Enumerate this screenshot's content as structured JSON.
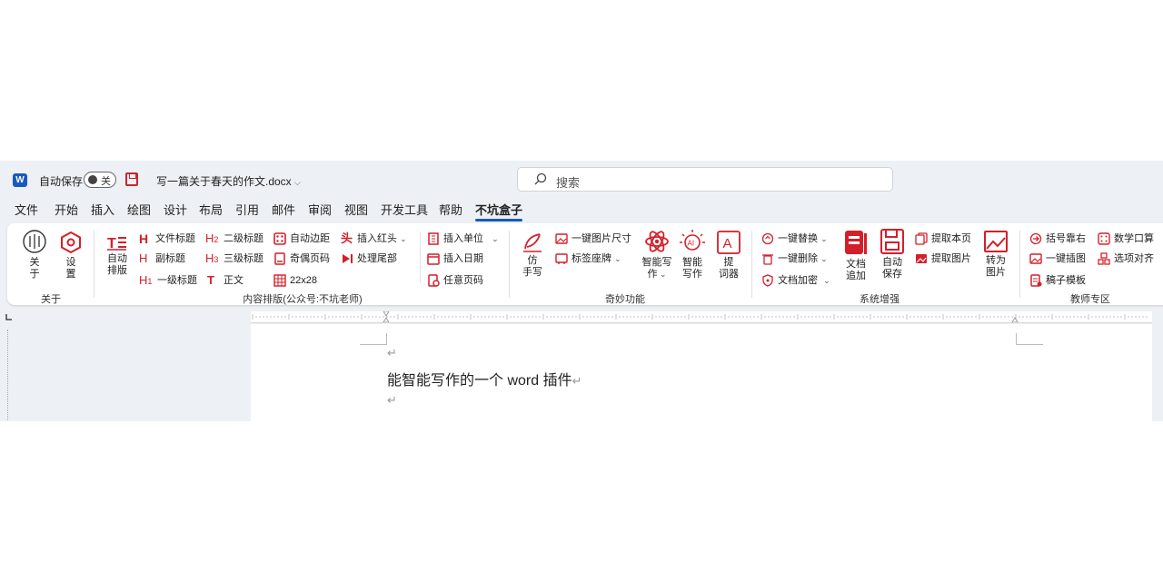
{
  "titlebar": {
    "app_logo": "W",
    "autosave_label": "自动保存",
    "autosave_state": "关",
    "doc_title": "写一篇关于春天的作文.docx",
    "search_placeholder": "搜索"
  },
  "tabs": [
    {
      "label": "文件"
    },
    {
      "label": "开始"
    },
    {
      "label": "插入"
    },
    {
      "label": "绘图"
    },
    {
      "label": "设计"
    },
    {
      "label": "布局"
    },
    {
      "label": "引用"
    },
    {
      "label": "邮件"
    },
    {
      "label": "审阅"
    },
    {
      "label": "视图"
    },
    {
      "label": "开发工具"
    },
    {
      "label": "帮助"
    },
    {
      "label": "不坑盒子",
      "active": true
    }
  ],
  "ribbon": {
    "about": {
      "group_label": "关于",
      "about_btn": "关\n于",
      "settings_btn": "设\n置"
    },
    "layout": {
      "group_label": "内容排版(公众号:不坑老师)",
      "auto_layout": "自动\n排版",
      "doc_title": "文件标题",
      "subtitle": "副标题",
      "h1": "一级标题",
      "h2": "二级标题",
      "h3": "三级标题",
      "body": "正文",
      "auto_margin": "自动边距",
      "odd_even_page": "奇偶页码",
      "grid": "22x28",
      "insert_redhead": "插入红头",
      "process_tail": "处理尾部",
      "insert_unit": "插入单位",
      "insert_date": "插入日期",
      "any_page_num": "任意页码"
    },
    "magic": {
      "group_label": "奇妙功能",
      "imitate": "仿\n手写",
      "img_size": "一键图片尺寸",
      "tag_seat": "标签座牌",
      "smart_write_menu": "智能写\n作",
      "smart_write": "智能\n写作",
      "prompt": "提\n词器"
    },
    "system": {
      "group_label": "系统增强",
      "replace": "一键替换",
      "delete": "一键删除",
      "encrypt": "文档加密",
      "doc_append": "文档\n追加",
      "auto_save": "自动\n保存",
      "extract_page": "提取本页",
      "extract_image": "提取图片",
      "to_image": "转为\n图片"
    },
    "teacher": {
      "group_label": "教师专区",
      "bracket_right": "括号靠右",
      "insert_image": "一键插图",
      "draft_template": "稿子模板",
      "mental_math": "数学口算",
      "align_options": "选项对齐"
    }
  },
  "document": {
    "line1": "能智能写作的一个 word 插件",
    "para_mark": "↵"
  },
  "colors": {
    "accent_red": "#d41f2a",
    "word_blue": "#185abd",
    "chrome_bg": "#edf0f4"
  }
}
